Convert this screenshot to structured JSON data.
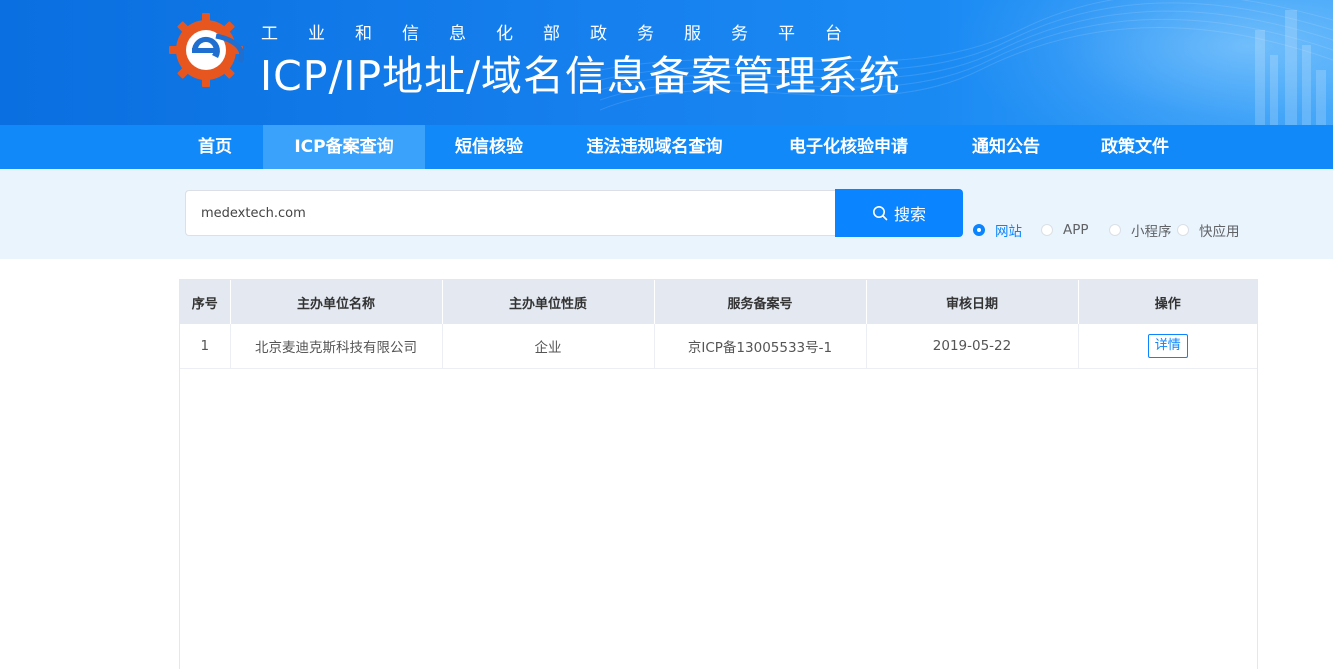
{
  "header": {
    "subtitle_chars": [
      "工",
      "业",
      "和",
      "信",
      "息",
      "化",
      "部",
      "政",
      "务",
      "服",
      "务",
      "平",
      "台"
    ],
    "title": "ICP/IP地址/域名信息备案管理系统"
  },
  "nav": {
    "items": [
      {
        "label": "首页",
        "active": false
      },
      {
        "label": "ICP备案查询",
        "active": true
      },
      {
        "label": "短信核验",
        "active": false
      },
      {
        "label": "违法违规域名查询",
        "active": false
      },
      {
        "label": "电子化核验申请",
        "active": false
      },
      {
        "label": "通知公告",
        "active": false
      },
      {
        "label": "政策文件",
        "active": false
      }
    ]
  },
  "search": {
    "value": "medextech.com",
    "button_label": "搜索",
    "options": [
      {
        "label": "网站",
        "checked": true
      },
      {
        "label": "APP",
        "checked": false
      },
      {
        "label": "小程序",
        "checked": false
      },
      {
        "label": "快应用",
        "checked": false
      }
    ]
  },
  "table": {
    "headers": [
      "序号",
      "主办单位名称",
      "主办单位性质",
      "服务备案号",
      "审核日期",
      "操作"
    ],
    "rows": [
      {
        "index": "1",
        "org": "北京麦迪克斯科技有限公司",
        "nature": "企业",
        "license": "京ICP备13005533号-1",
        "date": "2019-05-22",
        "action": "详情"
      }
    ]
  },
  "colors": {
    "primary": "#0a84ff",
    "nav_bg": "#1189f9",
    "nav_active": "#3aa2fb",
    "search_band": "#eaf4fd",
    "table_header": "#e3e8f1"
  },
  "icons": {
    "logo": "miit-gear-logo",
    "search": "search-icon"
  }
}
